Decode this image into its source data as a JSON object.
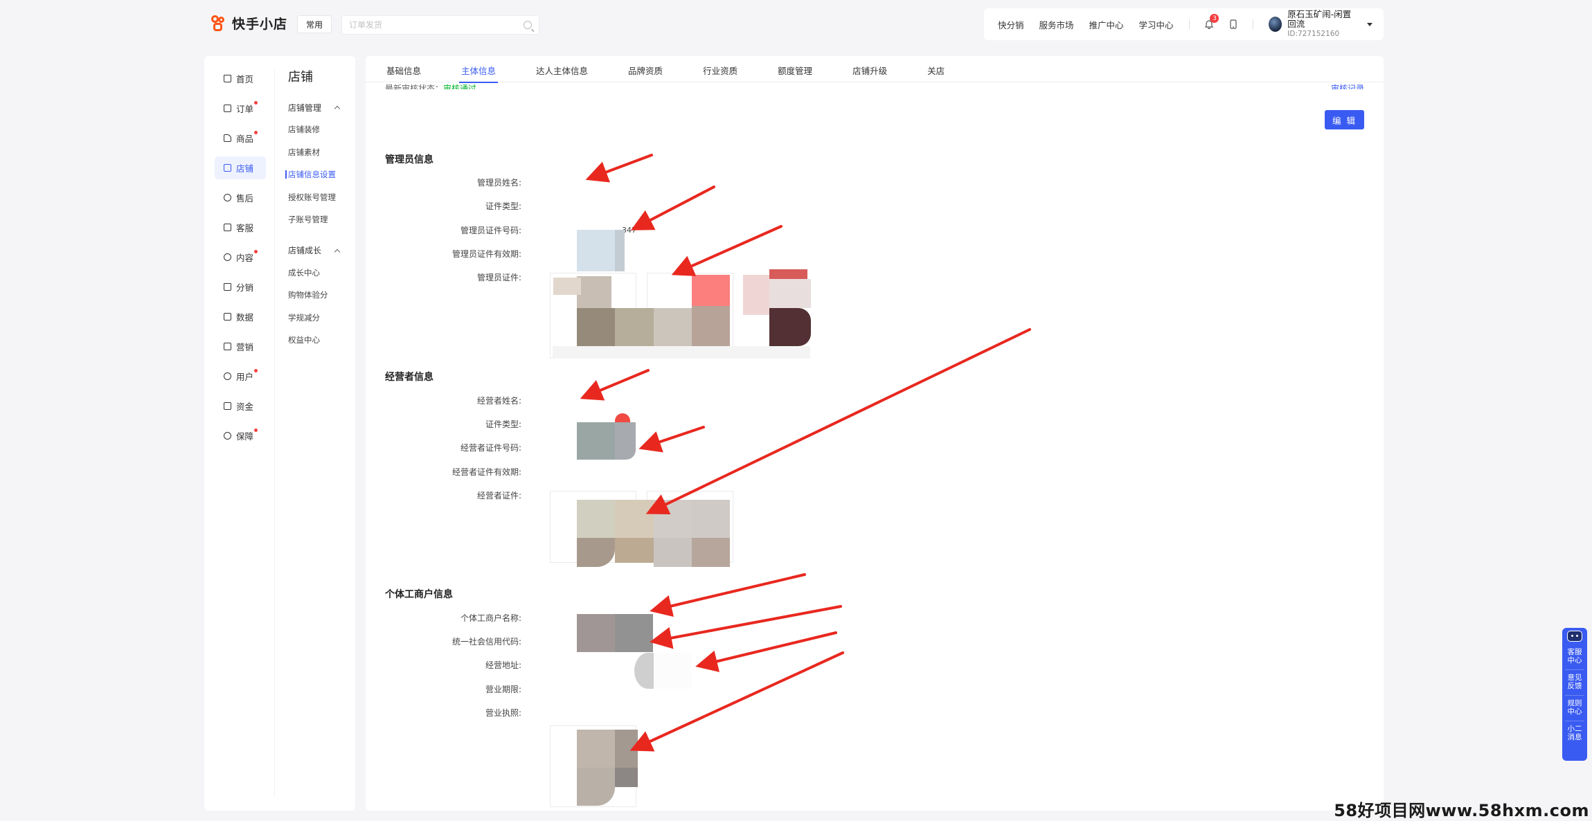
{
  "app": {
    "logo_text": "快手小店",
    "common_label": "常用",
    "search_placeholder": "订单发货"
  },
  "topnav": {
    "links": [
      "快分销",
      "服务市场",
      "推广中心",
      "学习中心"
    ],
    "notification_count": "3",
    "user_name": "原石玉矿闹-闲置回流",
    "user_id": "ID:727152160"
  },
  "sidebar": {
    "primary": [
      {
        "label": "首页",
        "icon": "home-icon",
        "dot": false,
        "active": false
      },
      {
        "label": "订单",
        "icon": "order-icon",
        "dot": true,
        "active": false
      },
      {
        "label": "商品",
        "icon": "goods-icon",
        "dot": true,
        "active": false
      },
      {
        "label": "店铺",
        "icon": "store-icon",
        "dot": false,
        "active": true
      },
      {
        "label": "售后",
        "icon": "aftersale-icon",
        "dot": false,
        "active": false
      },
      {
        "label": "客服",
        "icon": "service-icon",
        "dot": false,
        "active": false
      },
      {
        "label": "内容",
        "icon": "content-icon",
        "dot": true,
        "active": false
      },
      {
        "label": "分销",
        "icon": "distribution-icon",
        "dot": false,
        "active": false
      },
      {
        "label": "数据",
        "icon": "data-icon",
        "dot": false,
        "active": false
      },
      {
        "label": "营销",
        "icon": "marketing-icon",
        "dot": false,
        "active": false
      },
      {
        "label": "用户",
        "icon": "user-icon",
        "dot": true,
        "active": false
      },
      {
        "label": "资金",
        "icon": "funds-icon",
        "dot": false,
        "active": false
      },
      {
        "label": "保障",
        "icon": "shield-icon",
        "dot": true,
        "active": false
      }
    ],
    "secondary_title": "店铺",
    "groups": [
      {
        "title": "店铺管理",
        "items": [
          "店铺装修",
          "店铺素材",
          "店铺信息设置",
          "授权账号管理",
          "子账号管理"
        ]
      },
      {
        "title": "店铺成长",
        "items": [
          "成长中心",
          "购物体验分",
          "学规减分",
          "权益中心"
        ]
      }
    ],
    "active_item": "店铺信息设置"
  },
  "tabs": [
    "基础信息",
    "主体信息",
    "达人主体信息",
    "品牌资质",
    "行业资质",
    "额度管理",
    "店铺升级",
    "关店"
  ],
  "active_tab": "主体信息",
  "main": {
    "status_label": "最新审核状态：",
    "status_value": "审核通过",
    "audit_link": "审核记录",
    "edit_button": "编 辑",
    "sections": [
      {
        "title": "管理员信息",
        "fields": [
          "管理员姓名:",
          "证件类型:",
          "管理员证件号码:",
          "管理员证件有效期:",
          "管理员证件:"
        ],
        "id_fragment": "347"
      },
      {
        "title": "经营者信息",
        "fields": [
          "经营者姓名:",
          "证件类型:",
          "经营者证件号码:",
          "经营者证件有效期:",
          "经营者证件:"
        ]
      },
      {
        "title": "个体工商户信息",
        "fields": [
          "个体工商户名称:",
          "统一社会信用代码:",
          "经营地址:",
          "营业期限:",
          "营业执照:"
        ]
      }
    ]
  },
  "float_bar": [
    "客服中心",
    "意见反馈",
    "规则中心",
    "小二消息"
  ],
  "watermark": "58好项目网www.58hxm.com",
  "colors": {
    "accent": "#3a5bf1",
    "brand": "#fe5518",
    "success": "#00b42a",
    "alert": "#f53f3f",
    "annotation_arrow": "#e8281f"
  }
}
